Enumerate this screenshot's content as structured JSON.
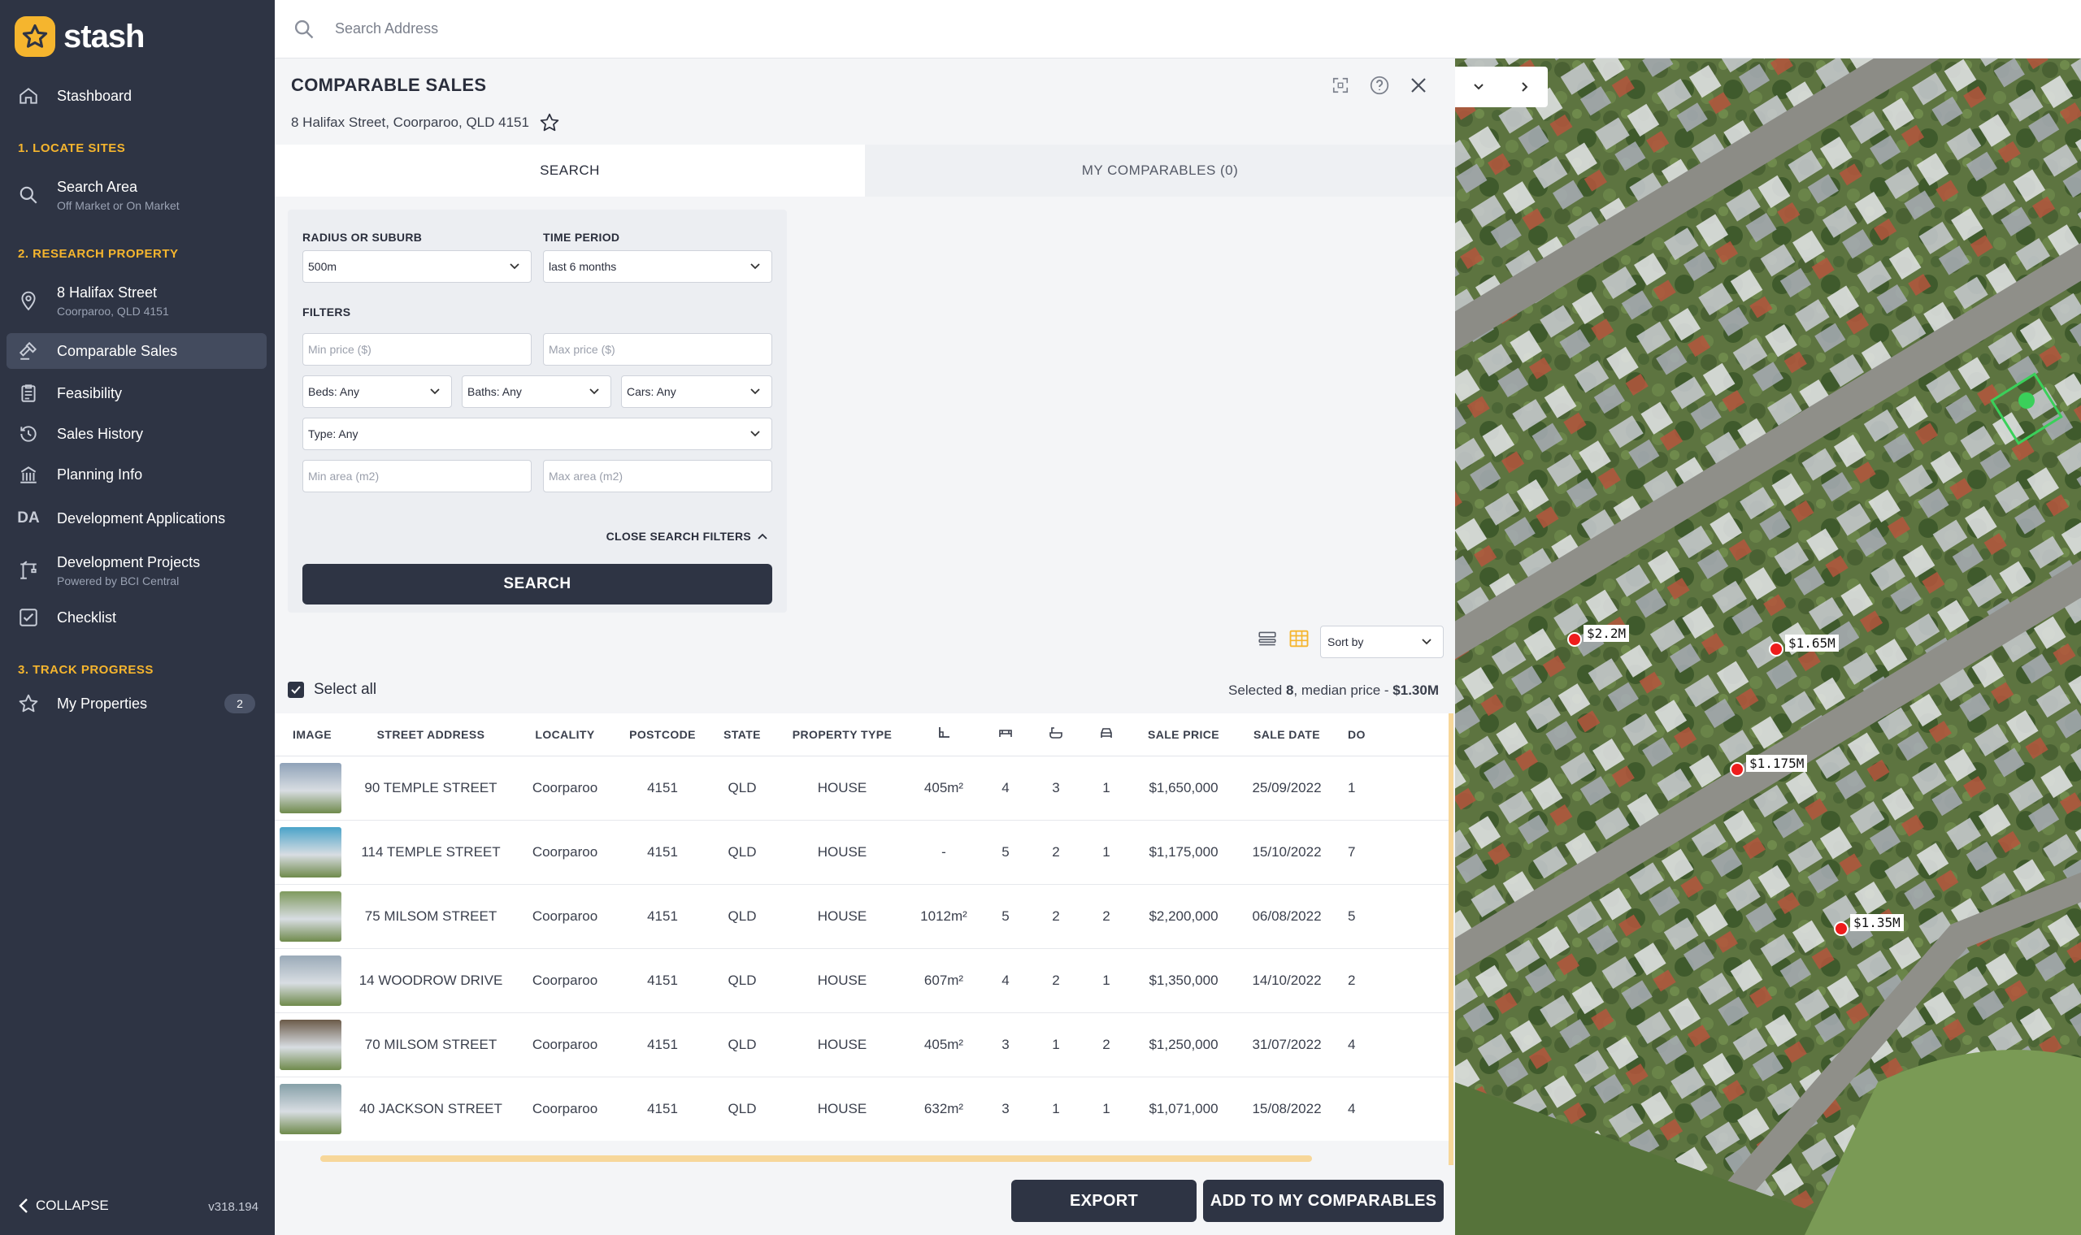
{
  "app": {
    "logo_text": "stash",
    "version": "v318.194",
    "collapse_label": "COLLAPSE"
  },
  "sidebar": {
    "stashboard": "Stashboard",
    "sections": {
      "locate": "1. LOCATE SITES",
      "research": "2. RESEARCH PROPERTY",
      "track": "3. TRACK PROGRESS"
    },
    "items": {
      "search_area": {
        "label": "Search Area",
        "sub": "Off Market or On Market"
      },
      "property": {
        "label": "8 Halifax Street",
        "sub": "Coorparoo, QLD 4151"
      },
      "comparable": {
        "label": "Comparable Sales"
      },
      "feasibility": {
        "label": "Feasibility"
      },
      "sales_history": {
        "label": "Sales History"
      },
      "planning": {
        "label": "Planning Info"
      },
      "dev_apps": {
        "label": "Development Applications",
        "icon_text": "DA"
      },
      "dev_projects": {
        "label": "Development Projects",
        "sub": "Powered by BCI Central"
      },
      "checklist": {
        "label": "Checklist"
      },
      "my_properties": {
        "label": "My Properties",
        "count": "2"
      }
    }
  },
  "topbar": {
    "search_placeholder": "Search Address"
  },
  "panel": {
    "title": "COMPARABLE SALES",
    "address": "8 Halifax Street, Coorparoo, QLD 4151",
    "tabs": {
      "search": "SEARCH",
      "my_comparables": "MY COMPARABLES (0)"
    },
    "filters": {
      "radius_label": "RADIUS OR SUBURB",
      "radius_value": "500m",
      "time_label": "TIME PERIOD",
      "time_value": "last 6 months",
      "filters_label": "FILTERS",
      "min_price": "Min price ($)",
      "max_price": "Max price ($)",
      "beds": "Beds: Any",
      "baths": "Baths: Any",
      "cars": "Cars: Any",
      "type": "Type: Any",
      "min_area": "Min area (m2)",
      "max_area": "Max area (m2)",
      "close_label": "CLOSE SEARCH FILTERS",
      "search_button": "SEARCH"
    },
    "sort_placeholder": "Sort by",
    "select_all": "Select all",
    "selected_prefix": "Selected ",
    "selected_count": "8",
    "selected_mid": ", median price - ",
    "median_price": "$1.30M",
    "table": {
      "headers": [
        "IMAGE",
        "STREET ADDRESS",
        "LOCALITY",
        "POSTCODE",
        "STATE",
        "PROPERTY TYPE",
        "",
        "",
        "",
        "",
        "SALE PRICE",
        "SALE DATE",
        "DO"
      ],
      "rows": [
        {
          "address": "90 TEMPLE STREET",
          "locality": "Coorparoo",
          "postcode": "4151",
          "state": "QLD",
          "type": "HOUSE",
          "area": "405m²",
          "beds": "4",
          "baths": "3",
          "cars": "1",
          "price": "$1,650,000",
          "date": "25/09/2022",
          "do": "1",
          "thumb": "#8fa2b8"
        },
        {
          "address": "114 TEMPLE STREET",
          "locality": "Coorparoo",
          "postcode": "4151",
          "state": "QLD",
          "type": "HOUSE",
          "area": "-",
          "beds": "5",
          "baths": "2",
          "cars": "1",
          "price": "$1,175,000",
          "date": "15/10/2022",
          "do": "7",
          "thumb": "#4aa3c9"
        },
        {
          "address": "75 MILSOM STREET",
          "locality": "Coorparoo",
          "postcode": "4151",
          "state": "QLD",
          "type": "HOUSE",
          "area": "1012m²",
          "beds": "5",
          "baths": "2",
          "cars": "2",
          "price": "$2,200,000",
          "date": "06/08/2022",
          "do": "5",
          "thumb": "#7f9a5e"
        },
        {
          "address": "14 WOODROW DRIVE",
          "locality": "Coorparoo",
          "postcode": "4151",
          "state": "QLD",
          "type": "HOUSE",
          "area": "607m²",
          "beds": "4",
          "baths": "2",
          "cars": "1",
          "price": "$1,350,000",
          "date": "14/10/2022",
          "do": "2",
          "thumb": "#9aaab8"
        },
        {
          "address": "70 MILSOM STREET",
          "locality": "Coorparoo",
          "postcode": "4151",
          "state": "QLD",
          "type": "HOUSE",
          "area": "405m²",
          "beds": "3",
          "baths": "1",
          "cars": "2",
          "price": "$1,250,000",
          "date": "31/07/2022",
          "do": "4",
          "thumb": "#6b5a48"
        },
        {
          "address": "40 JACKSON STREET",
          "locality": "Coorparoo",
          "postcode": "4151",
          "state": "QLD",
          "type": "HOUSE",
          "area": "632m²",
          "beds": "3",
          "baths": "1",
          "cars": "1",
          "price": "$1,071,000",
          "date": "15/08/2022",
          "do": "4",
          "thumb": "#86a0a8"
        }
      ]
    },
    "buttons": {
      "export": "EXPORT",
      "add": "ADD TO MY COMPARABLES"
    }
  },
  "map": {
    "pins": [
      {
        "label": "$2.2M"
      },
      {
        "label": "$1.65M"
      },
      {
        "label": "$1.175M"
      },
      {
        "label": "$1.35M"
      }
    ]
  },
  "colors": {
    "sidebar": "#2e3444",
    "accent": "#f5b52e",
    "pin": "#ee1c1c"
  }
}
